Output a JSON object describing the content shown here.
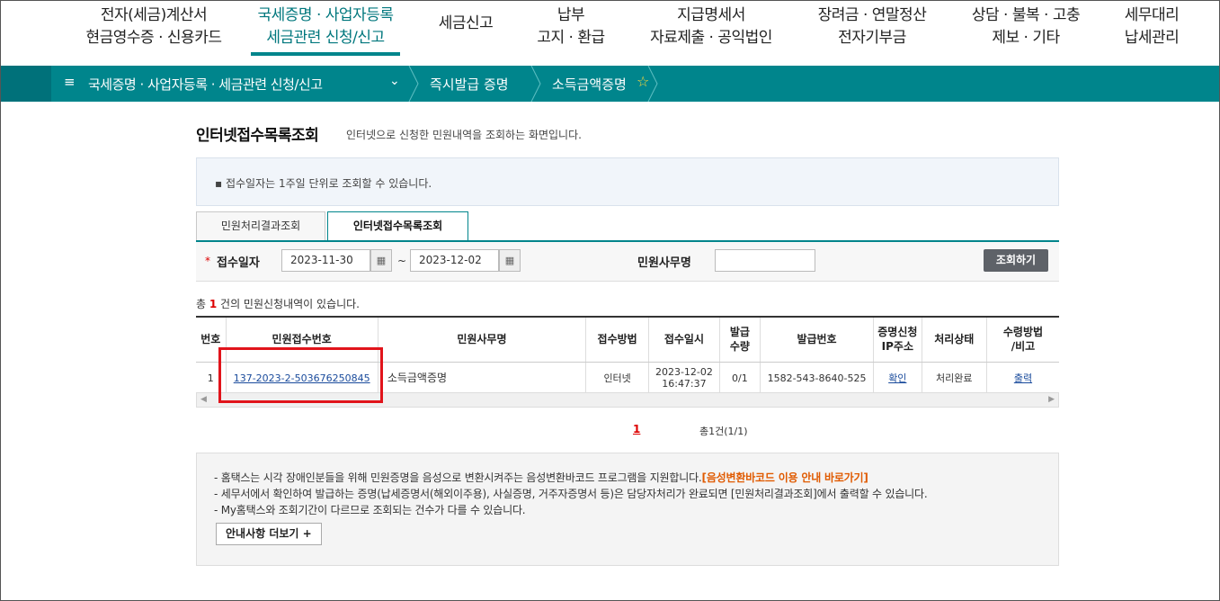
{
  "topnav": {
    "items": [
      {
        "line1": "전자(세금)계산서",
        "line2": "현금영수증 · 신용카드"
      },
      {
        "line1": "국세증명 · 사업자등록",
        "line2": "세금관련 신청/신고"
      },
      {
        "line1": "세금신고",
        "line2": ""
      },
      {
        "line1": "납부",
        "line2": "고지 · 환급"
      },
      {
        "line1": "지급명세서",
        "line2": "자료제출 · 공익법인"
      },
      {
        "line1": "장려금 · 연말정산",
        "line2": "전자기부금"
      },
      {
        "line1": "상담 · 불복 · 고충",
        "line2": "제보 · 기타"
      },
      {
        "line1": "세무대리",
        "line2": "납세관리"
      }
    ]
  },
  "breadcrumb": {
    "hamburger": "≡",
    "level1": "국세증명 · 사업자등록 · 세금관련 신청/신고",
    "chevron": "⌄",
    "level2": "즉시발급 증명",
    "level3": "소득금액증명",
    "star": "☆"
  },
  "page": {
    "title": "인터넷접수목록조회",
    "description": "인터넷으로 신청한 민원내역을 조회하는 화면입니다.",
    "notice": "▪ 접수일자는 1주일 단위로 조회할 수 있습니다."
  },
  "tabs": [
    "민원처리결과조회",
    "인터넷접수목록조회"
  ],
  "search": {
    "required_mark": "*",
    "date_label": "접수일자",
    "date_from": "2023-11-30",
    "date_to": "2023-12-02",
    "calendar_icon": "▦",
    "tilde": "~",
    "service_label": "민원사무명",
    "service_value": "",
    "button": "조회하기"
  },
  "count": {
    "prefix": "총 ",
    "n": "1",
    "suffix": " 건의 민원신청내역이 있습니다."
  },
  "table": {
    "headers": [
      "번호",
      "민원접수번호",
      "민원사무명",
      "접수방법",
      "접수일시",
      "발급\n수량",
      "발급번호",
      "증명신청\nIP주소",
      "처리상태",
      "수령방법\n/비고"
    ],
    "rows": [
      {
        "no": "1",
        "receipt_no": "137-2023-2-503676250845",
        "service": "소득금액증명",
        "method": "인터넷",
        "date": "2023-12-02",
        "time": "16:47:37",
        "qty": "0/1",
        "issue_no": "1582-543-8640-525",
        "ip": "확인",
        "status": "처리완료",
        "receive": "출력"
      }
    ]
  },
  "paging": {
    "current": "1",
    "summary": "총1건(1/1)"
  },
  "info": {
    "line1": "- 홈택스는 시각 장애인분들을 위해 민원증명을 음성으로 변환시켜주는 음성변환바코드 프로그램을 지원합니다.",
    "line1_link": "[음성변환바코드 이용 안내 바로가기]",
    "line2": "- 세무서에서 확인하여 발급하는 증명(납세증명서(해외이주용), 사실증명, 거주자증명서 등)은 담당자처리가 완료되면 [민원처리결과조회]에서 출력할 수 있습니다.",
    "line3": "- My홈택스와 조회기간이 다르므로 조회되는 건수가 다를 수 있습니다.",
    "more_button": "안내사항 더보기 +"
  }
}
